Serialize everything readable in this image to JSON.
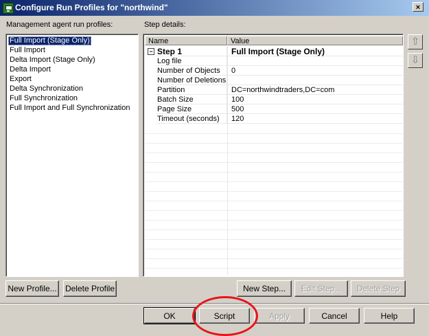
{
  "window": {
    "title": "Configure Run Profiles for \"northwind\"",
    "close_label": "×"
  },
  "profiles": {
    "label": "Management agent run profiles:",
    "items": [
      {
        "label": "Full Import (Stage Only)",
        "selected": true
      },
      {
        "label": "Full Import",
        "selected": false
      },
      {
        "label": "Delta Import (Stage Only)",
        "selected": false
      },
      {
        "label": "Delta Import",
        "selected": false
      },
      {
        "label": "Export",
        "selected": false
      },
      {
        "label": "Delta Synchronization",
        "selected": false
      },
      {
        "label": "Full Synchronization",
        "selected": false
      },
      {
        "label": "Full Import and Full Synchronization",
        "selected": false
      }
    ],
    "new_label": "New Profile...",
    "delete_label": "Delete Profile"
  },
  "steps": {
    "label": "Step details:",
    "columns": {
      "name": "Name",
      "value": "Value"
    },
    "step": {
      "expander": "−",
      "name": "Step 1",
      "value": "Full Import (Stage Only)"
    },
    "rows": [
      {
        "name": "Log file",
        "value": ""
      },
      {
        "name": "Number of Objects",
        "value": "0"
      },
      {
        "name": "Number of Deletions",
        "value": ""
      },
      {
        "name": "Partition",
        "value": "DC=northwindtraders,DC=com"
      },
      {
        "name": "Batch Size",
        "value": "100"
      },
      {
        "name": "Page Size",
        "value": "500"
      },
      {
        "name": "Timeout (seconds)",
        "value": "120"
      }
    ],
    "move_up_icon": "up-arrow-icon",
    "move_down_icon": "down-arrow-icon",
    "new_label": "New Step...",
    "edit_label": "Edit Step...",
    "delete_label": "Delete Step"
  },
  "footer": {
    "ok": "OK",
    "script": "Script",
    "apply": "Apply",
    "cancel": "Cancel",
    "help": "Help"
  },
  "colors": {
    "selection": "#0a246a",
    "annotation": "#e8141b"
  }
}
